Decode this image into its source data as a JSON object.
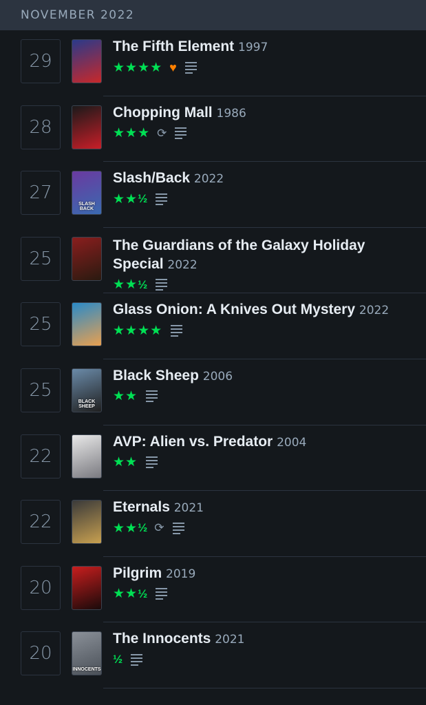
{
  "header": {
    "month": "NOVEMBER 2022"
  },
  "entries": [
    {
      "day": "29",
      "title": "The Fifth Element",
      "year": "1997",
      "stars": "★★★★",
      "half": "",
      "liked": true,
      "rewatch": false,
      "review": true,
      "poster_colors": [
        "#2a3a8a",
        "#c8282a"
      ],
      "poster_text": ""
    },
    {
      "day": "28",
      "title": "Chopping Mall",
      "year": "1986",
      "stars": "★★★",
      "half": "",
      "liked": false,
      "rewatch": true,
      "review": true,
      "poster_colors": [
        "#1a1a1a",
        "#c81e28"
      ],
      "poster_text": ""
    },
    {
      "day": "27",
      "title": "Slash/Back",
      "year": "2022",
      "stars": "★★",
      "half": "½",
      "liked": false,
      "rewatch": false,
      "review": true,
      "poster_colors": [
        "#6a3aa0",
        "#3a6ab0"
      ],
      "poster_text": "SLASH BACK"
    },
    {
      "day": "25",
      "title": "The Guardians of the Galaxy Holiday Special",
      "year": "2022",
      "stars": "★★",
      "half": "½",
      "liked": false,
      "rewatch": false,
      "review": true,
      "poster_colors": [
        "#8a1e1e",
        "#2a1a10"
      ],
      "poster_text": ""
    },
    {
      "day": "25",
      "title": "Glass Onion: A Knives Out Mystery",
      "year": "2022",
      "stars": "★★★★",
      "half": "",
      "liked": false,
      "rewatch": false,
      "review": true,
      "poster_colors": [
        "#2a8ac8",
        "#e8a050"
      ],
      "poster_text": ""
    },
    {
      "day": "25",
      "title": "Black Sheep",
      "year": "2006",
      "stars": "★★",
      "half": "",
      "liked": false,
      "rewatch": false,
      "review": true,
      "poster_colors": [
        "#6a8aa8",
        "#202020"
      ],
      "poster_text": "BLACK SHEEP"
    },
    {
      "day": "22",
      "title": "AVP: Alien vs. Predator",
      "year": "2004",
      "stars": "★★",
      "half": "",
      "liked": false,
      "rewatch": false,
      "review": true,
      "poster_colors": [
        "#e8e8e8",
        "#7a7a80"
      ],
      "poster_text": ""
    },
    {
      "day": "22",
      "title": "Eternals",
      "year": "2021",
      "stars": "★★",
      "half": "½",
      "liked": false,
      "rewatch": true,
      "review": true,
      "poster_colors": [
        "#3a3a3a",
        "#c8a050"
      ],
      "poster_text": ""
    },
    {
      "day": "20",
      "title": "Pilgrim",
      "year": "2019",
      "stars": "★★",
      "half": "½",
      "liked": false,
      "rewatch": false,
      "review": true,
      "poster_colors": [
        "#c81e1e",
        "#1a0a0a"
      ],
      "poster_text": ""
    },
    {
      "day": "20",
      "title": "The Innocents",
      "year": "2021",
      "stars": "",
      "half": "½",
      "liked": false,
      "rewatch": false,
      "review": true,
      "poster_colors": [
        "#8a9098",
        "#4a5058"
      ],
      "poster_text": "INNOCENTS"
    }
  ],
  "icons": {
    "heart": "♥",
    "rewatch": "⟳"
  },
  "colors": {
    "background": "#14181c",
    "header": "#2c3440",
    "star": "#00e054",
    "liked": "#ff8000",
    "muted": "#8899aa"
  }
}
